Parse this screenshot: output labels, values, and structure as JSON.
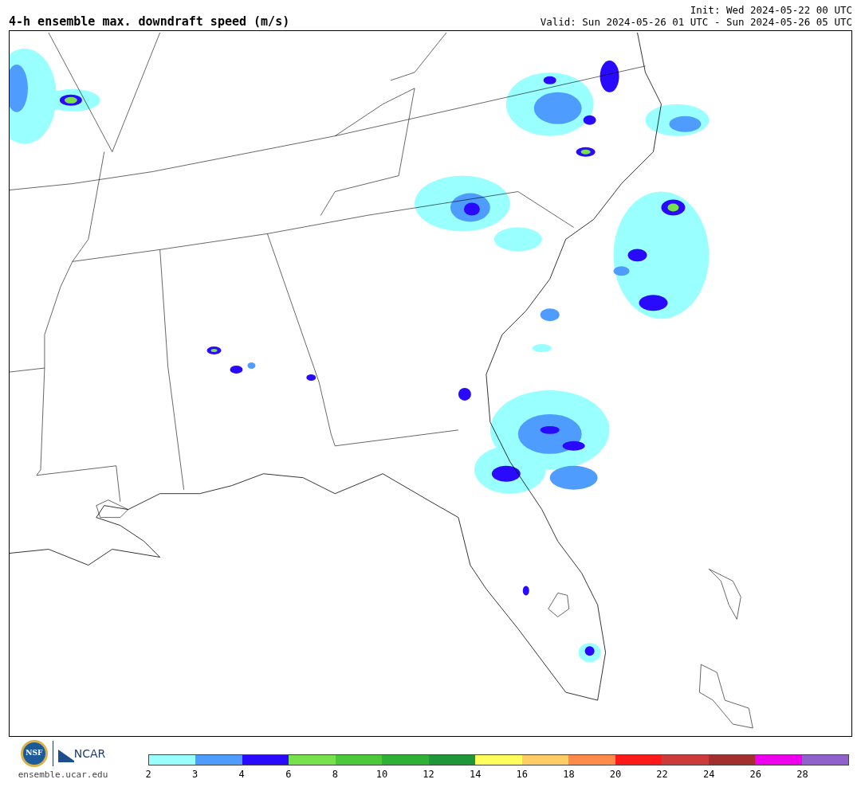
{
  "header": {
    "title": "4-h ensemble max. downdraft speed (m/s)",
    "init": "Init: Wed 2024-05-22 00 UTC",
    "valid": "Valid: Sun 2024-05-26 01 UTC - Sun 2024-05-26 05 UTC"
  },
  "logos": {
    "nsf": "NSF",
    "ncar": "NCAR",
    "url": "ensemble.ucar.edu"
  },
  "colorbar": {
    "bins": [
      {
        "color": "#99ffff"
      },
      {
        "color": "#4f9cff"
      },
      {
        "color": "#2a0aff"
      },
      {
        "color": "#77e24b"
      },
      {
        "color": "#4bc93b"
      },
      {
        "color": "#2fb136"
      },
      {
        "color": "#1f9638"
      },
      {
        "color": "#ffff5c"
      },
      {
        "color": "#ffcc66"
      },
      {
        "color": "#ff8a4a"
      },
      {
        "color": "#ff1a1a"
      },
      {
        "color": "#cc3a3a"
      },
      {
        "color": "#a32e2e"
      },
      {
        "color": "#ee00ee"
      },
      {
        "color": "#9060cc"
      }
    ],
    "ticks": [
      "2",
      "3",
      "4",
      "6",
      "8",
      "10",
      "12",
      "14",
      "16",
      "18",
      "20",
      "22",
      "24",
      "26",
      "28"
    ]
  }
}
